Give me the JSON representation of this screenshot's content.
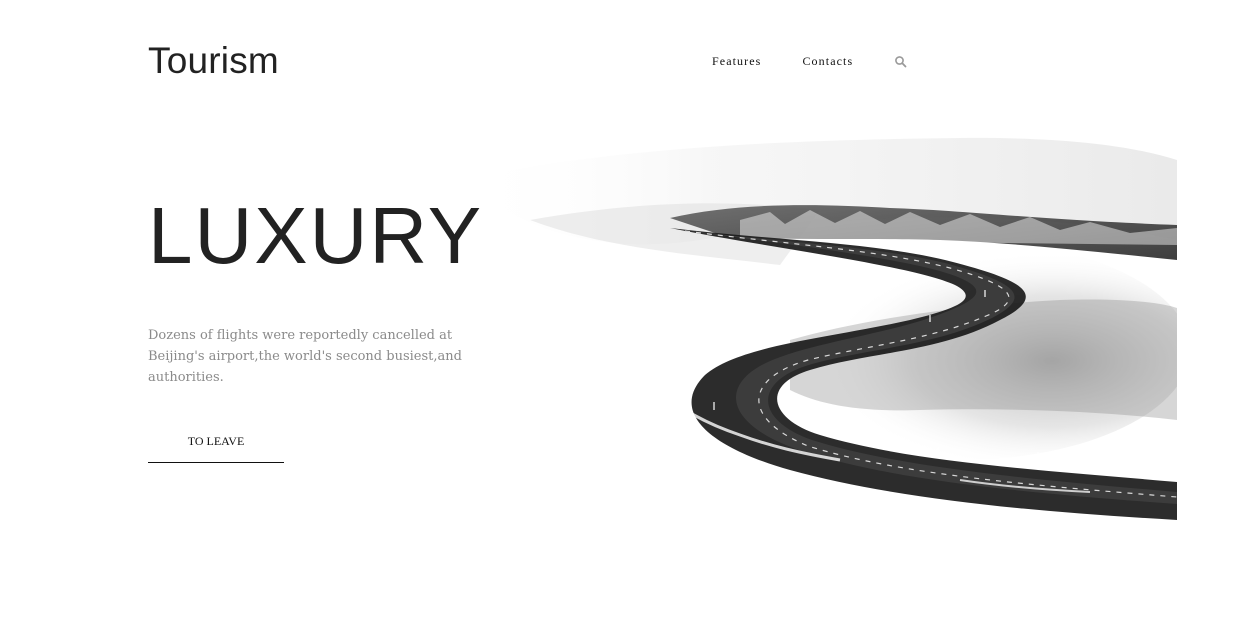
{
  "header": {
    "brand": "Tourism",
    "nav": [
      "Features",
      "Contacts"
    ],
    "search_icon": "search-icon"
  },
  "hero": {
    "title": "LUXURY",
    "description": "Dozens of flights were reportedly cancelled at Beijing's airport,the world's second busiest,and authorities.",
    "cta_label": "TO LEAVE"
  },
  "colors": {
    "text_dark": "#222222",
    "text_muted": "#8a8a8a",
    "road": "#2b2b2b"
  }
}
